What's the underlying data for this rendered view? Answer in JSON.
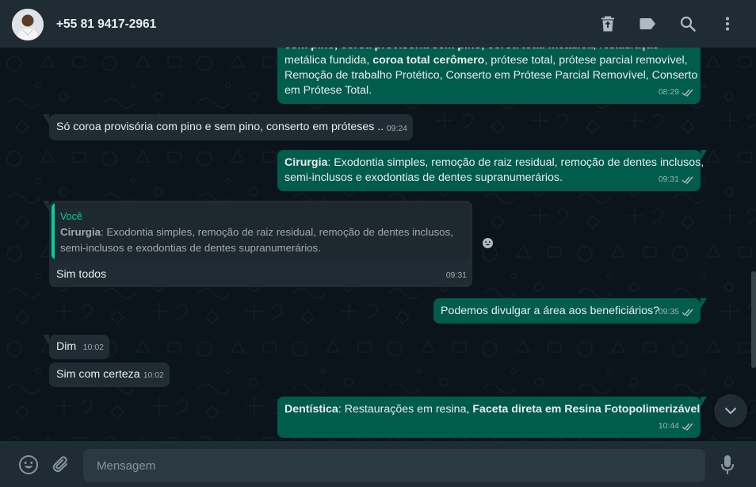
{
  "header": {
    "contact_name": "+55 81 9417-2961"
  },
  "messages": [
    {
      "id": "m1",
      "direction": "out",
      "lines_html": [
        "<b>com pino, coroa provisória sem pino, coroa total metálica</b>, restauração",
        "metálica fundida, <b>coroa total cerômero</b>, prótese total, prótese parcial removível,",
        "Remoção de trabalho Protético, Conserto em Prótese Parcial Removível, Conserto",
        "em Prótese Total."
      ],
      "time": "08:29"
    },
    {
      "id": "m2",
      "direction": "in",
      "text": "Só coroa provisória com pino e sem pino, conserto em próteses ..",
      "time": "09:24"
    },
    {
      "id": "m3",
      "direction": "out",
      "bold": "Cirurgia",
      "line1": ": Exodontia simples, remoção de raiz residual, remoção de dentes inclusos,",
      "line2": "semi-inclusos e exodontias de dentes supranumerários.",
      "time": "09:31"
    },
    {
      "id": "m4",
      "direction": "in",
      "quote_author": "Você",
      "quote_bold": "Cirurgia",
      "quote_line1": ": Exodontia simples, remoção de raiz residual, remoção de dentes inclusos,",
      "quote_line2": "semi-inclusos e exodontias de dentes supranumerários.",
      "text": "Sim todos",
      "time": "09:31"
    },
    {
      "id": "m5",
      "direction": "out",
      "text": "Podemos divulgar a área aos beneficiários?",
      "time": "09:35"
    },
    {
      "id": "m6",
      "direction": "in",
      "text": "Dim",
      "time": "10:02"
    },
    {
      "id": "m7",
      "direction": "in",
      "text": "Sim com certeza",
      "time": "10:02"
    },
    {
      "id": "m8",
      "direction": "out",
      "bold1": "Dentística",
      "mid": ": Restaurações em resina, ",
      "bold2": "Faceta direta em Resina Fotopolimerizável",
      "time": "10:44"
    }
  ],
  "composer": {
    "placeholder": "Mensagem"
  },
  "colors": {
    "outgoing_bubble": "#005c4b",
    "incoming_bubble": "#202c33",
    "panel": "#202c33",
    "background": "#0b141a",
    "accent": "#06cf9c",
    "read_check": "#53bdeb"
  },
  "icons": {
    "header": [
      "trash-icon",
      "label-icon",
      "search-icon",
      "menu-icon"
    ],
    "footer": [
      "emoji-icon",
      "attach-icon",
      "mic-icon"
    ]
  }
}
